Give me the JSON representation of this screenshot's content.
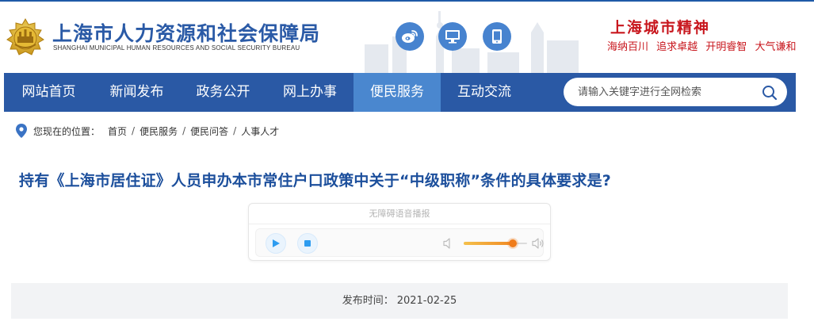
{
  "header": {
    "title": "上海市人力资源和社会保障局",
    "subtitle": "SHANGHAI MUNICIPAL HUMAN RESOURCES AND SOCIAL SECURITY BUREAU",
    "social": [
      {
        "icon": "weibo-icon"
      },
      {
        "icon": "computer-icon"
      },
      {
        "icon": "mobile-icon"
      }
    ],
    "spirit_title": "上海城市精神",
    "spirit_motto": [
      "海纳百川",
      "追求卓越",
      "开明睿智",
      "大气谦和"
    ],
    "colors": {
      "brand": "#2a5aa6",
      "spirit": "#c8161d"
    }
  },
  "nav": {
    "items": [
      {
        "label": "网站首页",
        "active": false
      },
      {
        "label": "新闻发布",
        "active": false
      },
      {
        "label": "政务公开",
        "active": false
      },
      {
        "label": "网上办事",
        "active": false
      },
      {
        "label": "便民服务",
        "active": true
      },
      {
        "label": "互动交流",
        "active": false
      }
    ],
    "search": {
      "placeholder": "请输入关键字进行全网检索",
      "value": "",
      "icon": "search-icon"
    },
    "colors": {
      "background": "#2a59a5",
      "active": "#4a87cf"
    }
  },
  "breadcrumb": {
    "label": "您现在的位置：",
    "icon": "location-pin-icon",
    "items": [
      "首页",
      "便民服务",
      "便民问答",
      "人事人才"
    ],
    "separator": "/"
  },
  "article": {
    "title": "持有《上海市居住证》人员申办本市常住户口政策中关于“中级职称”条件的具体要求是?"
  },
  "player": {
    "heading": "无障碍语音播报",
    "play_icon": "play-icon",
    "stop_icon": "stop-icon",
    "volume_low_icon": "volume-low-icon",
    "volume_high_icon": "volume-high-icon",
    "volume_level": 0.78
  },
  "publish": {
    "label": "发布时间：",
    "date": "2021-02-25"
  }
}
